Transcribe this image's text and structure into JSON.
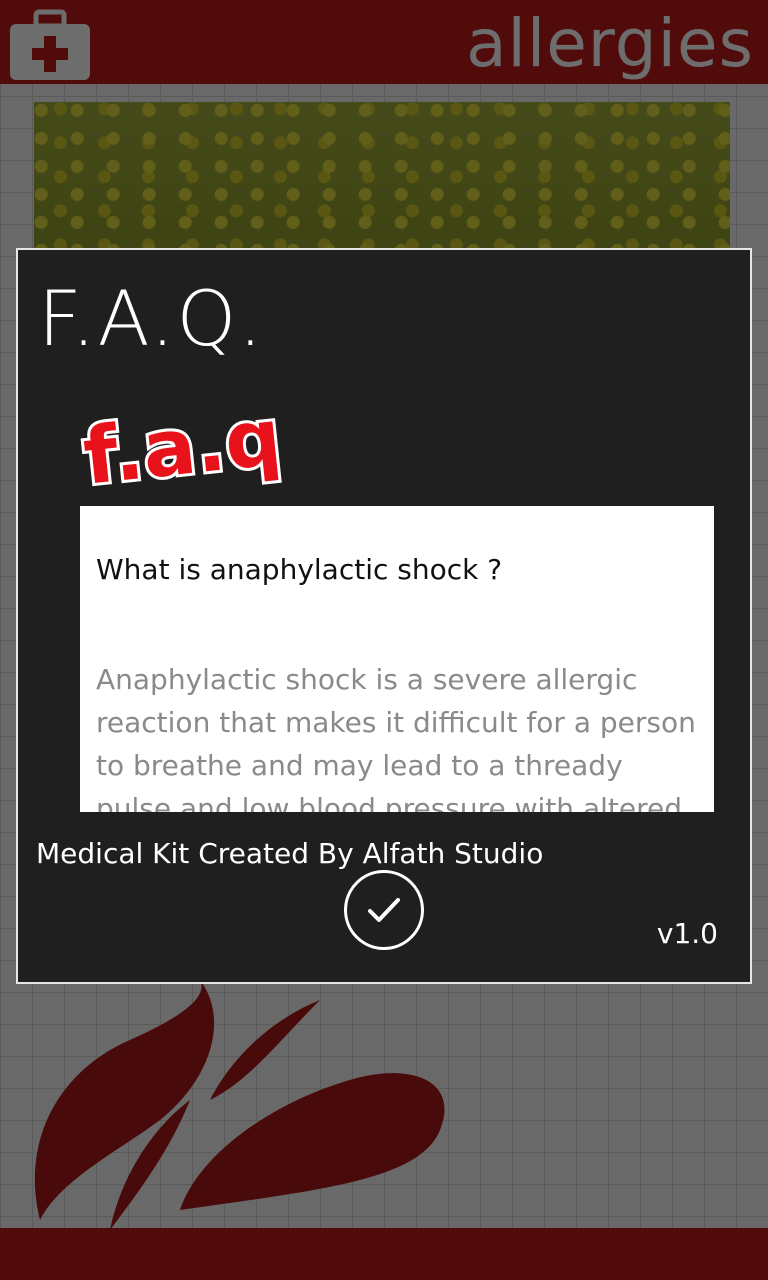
{
  "app": {
    "title": "allergies",
    "icon": "first-aid-kit-icon",
    "brand_color": "#b51a1a"
  },
  "dialog": {
    "title": "F.A.Q.",
    "logo_text": "f.a.q",
    "question": "What is anaphylactic shock ?",
    "answer": "Anaphylactic shock is a severe allergic reaction that makes it difficult for a person to breathe and may lead to a thready pulse and low blood pressure with altered",
    "credit": "Medical Kit Created By Alfath Studio",
    "ok_icon": "checkmark-circle-icon",
    "version": "v1.0"
  }
}
